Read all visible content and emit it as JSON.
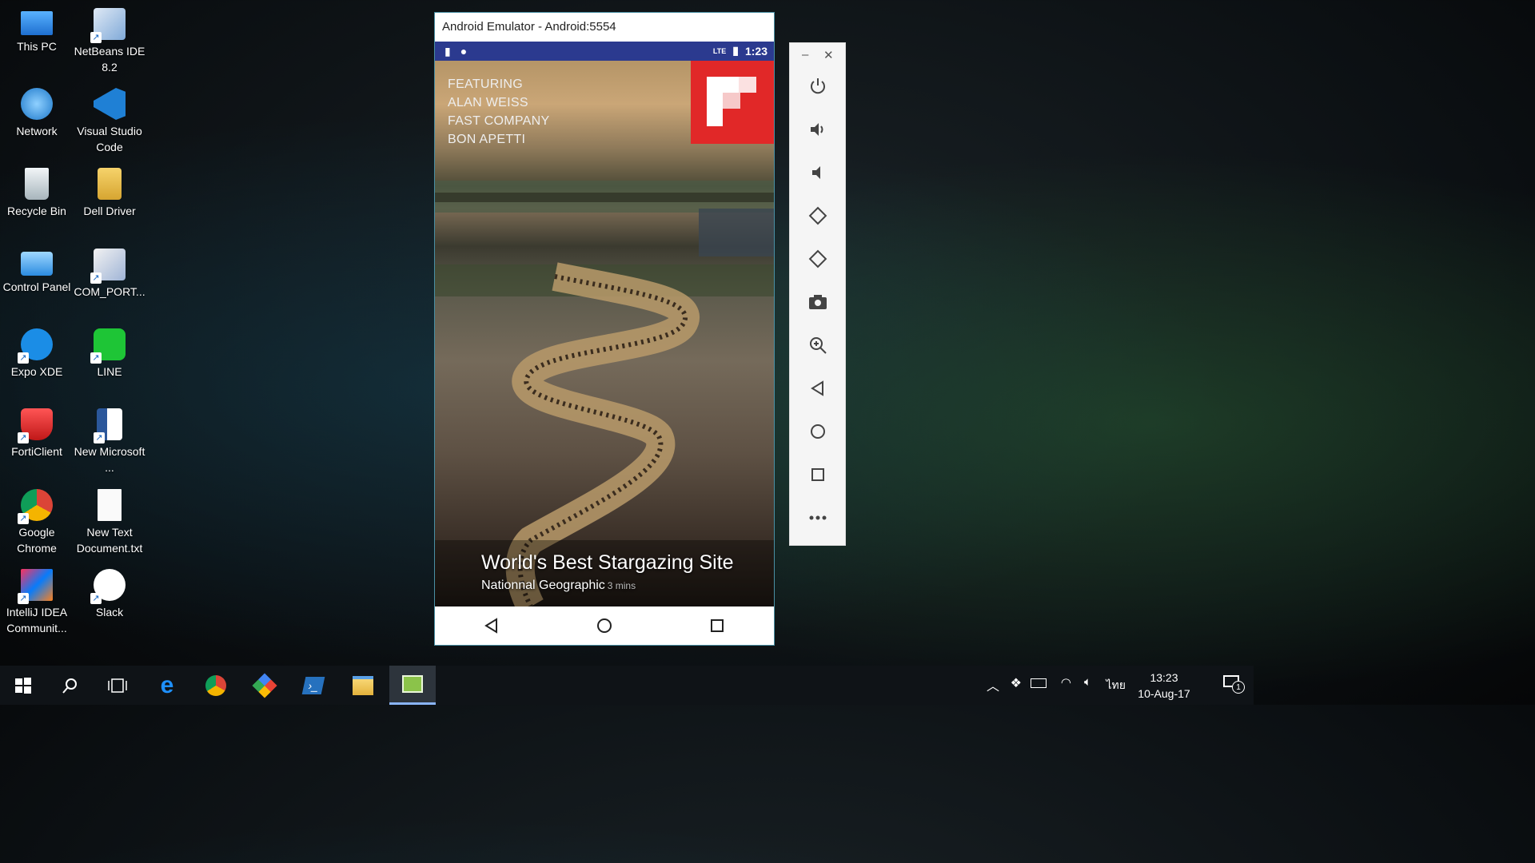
{
  "desktop": {
    "icons": [
      {
        "label": "This PC",
        "icon": "this-pc-icon"
      },
      {
        "label": "NetBeans IDE 8.2",
        "icon": "netbeans-icon"
      },
      {
        "label": "Network",
        "icon": "network-icon"
      },
      {
        "label": "Visual Studio Code",
        "icon": "vscode-icon"
      },
      {
        "label": "Recycle Bin",
        "icon": "recycle-bin-icon"
      },
      {
        "label": "Dell Driver",
        "icon": "folder-icon"
      },
      {
        "label": "Control Panel",
        "icon": "control-panel-icon"
      },
      {
        "label": "COM_PORT...",
        "icon": "com-port-icon"
      },
      {
        "label": "Expo XDE",
        "icon": "expo-icon"
      },
      {
        "label": "LINE",
        "icon": "line-icon"
      },
      {
        "label": "FortiClient",
        "icon": "forticlient-icon"
      },
      {
        "label": "New Microsoft ...",
        "icon": "word-doc-icon"
      },
      {
        "label": "Google Chrome",
        "icon": "chrome-icon"
      },
      {
        "label": "New Text Document.txt",
        "icon": "text-doc-icon"
      },
      {
        "label": "IntelliJ IDEA Communit...",
        "icon": "intellij-icon"
      },
      {
        "label": "Slack",
        "icon": "slack-icon"
      }
    ]
  },
  "emulator": {
    "title": "Android Emulator - Android:5554",
    "status_bar": {
      "time": "1:23",
      "network": "LTE"
    },
    "screen": {
      "featuring": [
        "FEATURING",
        "ALAN WEISS",
        "FAST COMPANY",
        "BON APETTI"
      ],
      "headline": "World's Best Stargazing Site",
      "source": "Nationnal Geographic",
      "duration": "3 mins"
    },
    "nav": [
      "back",
      "home",
      "recents"
    ]
  },
  "toolbar": {
    "tools": [
      "power-icon",
      "volume-up-icon",
      "volume-down-icon",
      "rotate-left-icon",
      "rotate-right-icon",
      "camera-icon",
      "zoom-icon",
      "back-icon",
      "home-icon",
      "overview-icon",
      "more-icon"
    ],
    "minimize": "–",
    "close": "✕"
  },
  "taskbar": {
    "apps": [
      "start-icon",
      "search-icon",
      "task-view-icon",
      "edge-icon",
      "chrome-icon",
      "git-icon",
      "powershell-icon",
      "file-explorer-icon",
      "android-emulator-icon"
    ],
    "language": "ไทย",
    "time": "13:23",
    "date": "10-Aug-17",
    "notification_count": "1"
  },
  "colors": {
    "status_bar": "#2b3a8f",
    "flipboard_red": "#e12828",
    "taskbar": "#0f1317"
  }
}
